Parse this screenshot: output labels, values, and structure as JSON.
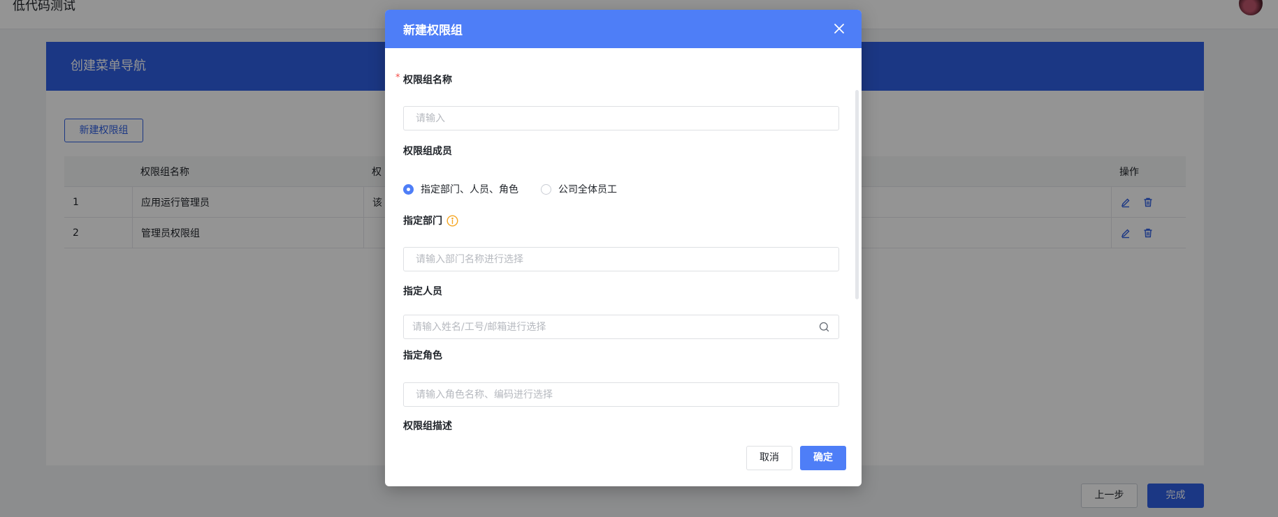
{
  "app": {
    "title": "低代码测试"
  },
  "card": {
    "header_title": "创建菜单导航",
    "new_group_label": "新建权限组",
    "table": {
      "columns": {
        "index": "",
        "name": "权限组名称",
        "desc": "权",
        "ops": "操作"
      },
      "rows": [
        {
          "index": "1",
          "name": "应用运行管理员",
          "desc": "该"
        },
        {
          "index": "2",
          "name": "管理员权限组",
          "desc": ""
        }
      ]
    }
  },
  "footer": {
    "prev_label": "上一步",
    "done_label": "完成"
  },
  "modal": {
    "title": "新建权限组",
    "fields": {
      "name": {
        "label": "权限组名称",
        "required_mark": "*",
        "placeholder": "请输入"
      },
      "members": {
        "label": "权限组成员",
        "options": [
          {
            "label": "指定部门、人员、角色",
            "checked": true
          },
          {
            "label": "公司全体员工",
            "checked": false
          }
        ]
      },
      "department": {
        "label": "指定部门",
        "placeholder": "请输入部门名称进行选择"
      },
      "people": {
        "label": "指定人员",
        "placeholder": "请输入姓名/工号/邮箱进行选择"
      },
      "role": {
        "label": "指定角色",
        "placeholder": "请输入角色名称、编码进行选择"
      },
      "description": {
        "label": "权限组描述"
      }
    },
    "cancel_label": "取消",
    "confirm_label": "确定"
  },
  "colors": {
    "primary": "#2f5fe3",
    "modal_header": "#4e7ef7",
    "info_icon": "#f5a623",
    "required": "#f54a45"
  }
}
